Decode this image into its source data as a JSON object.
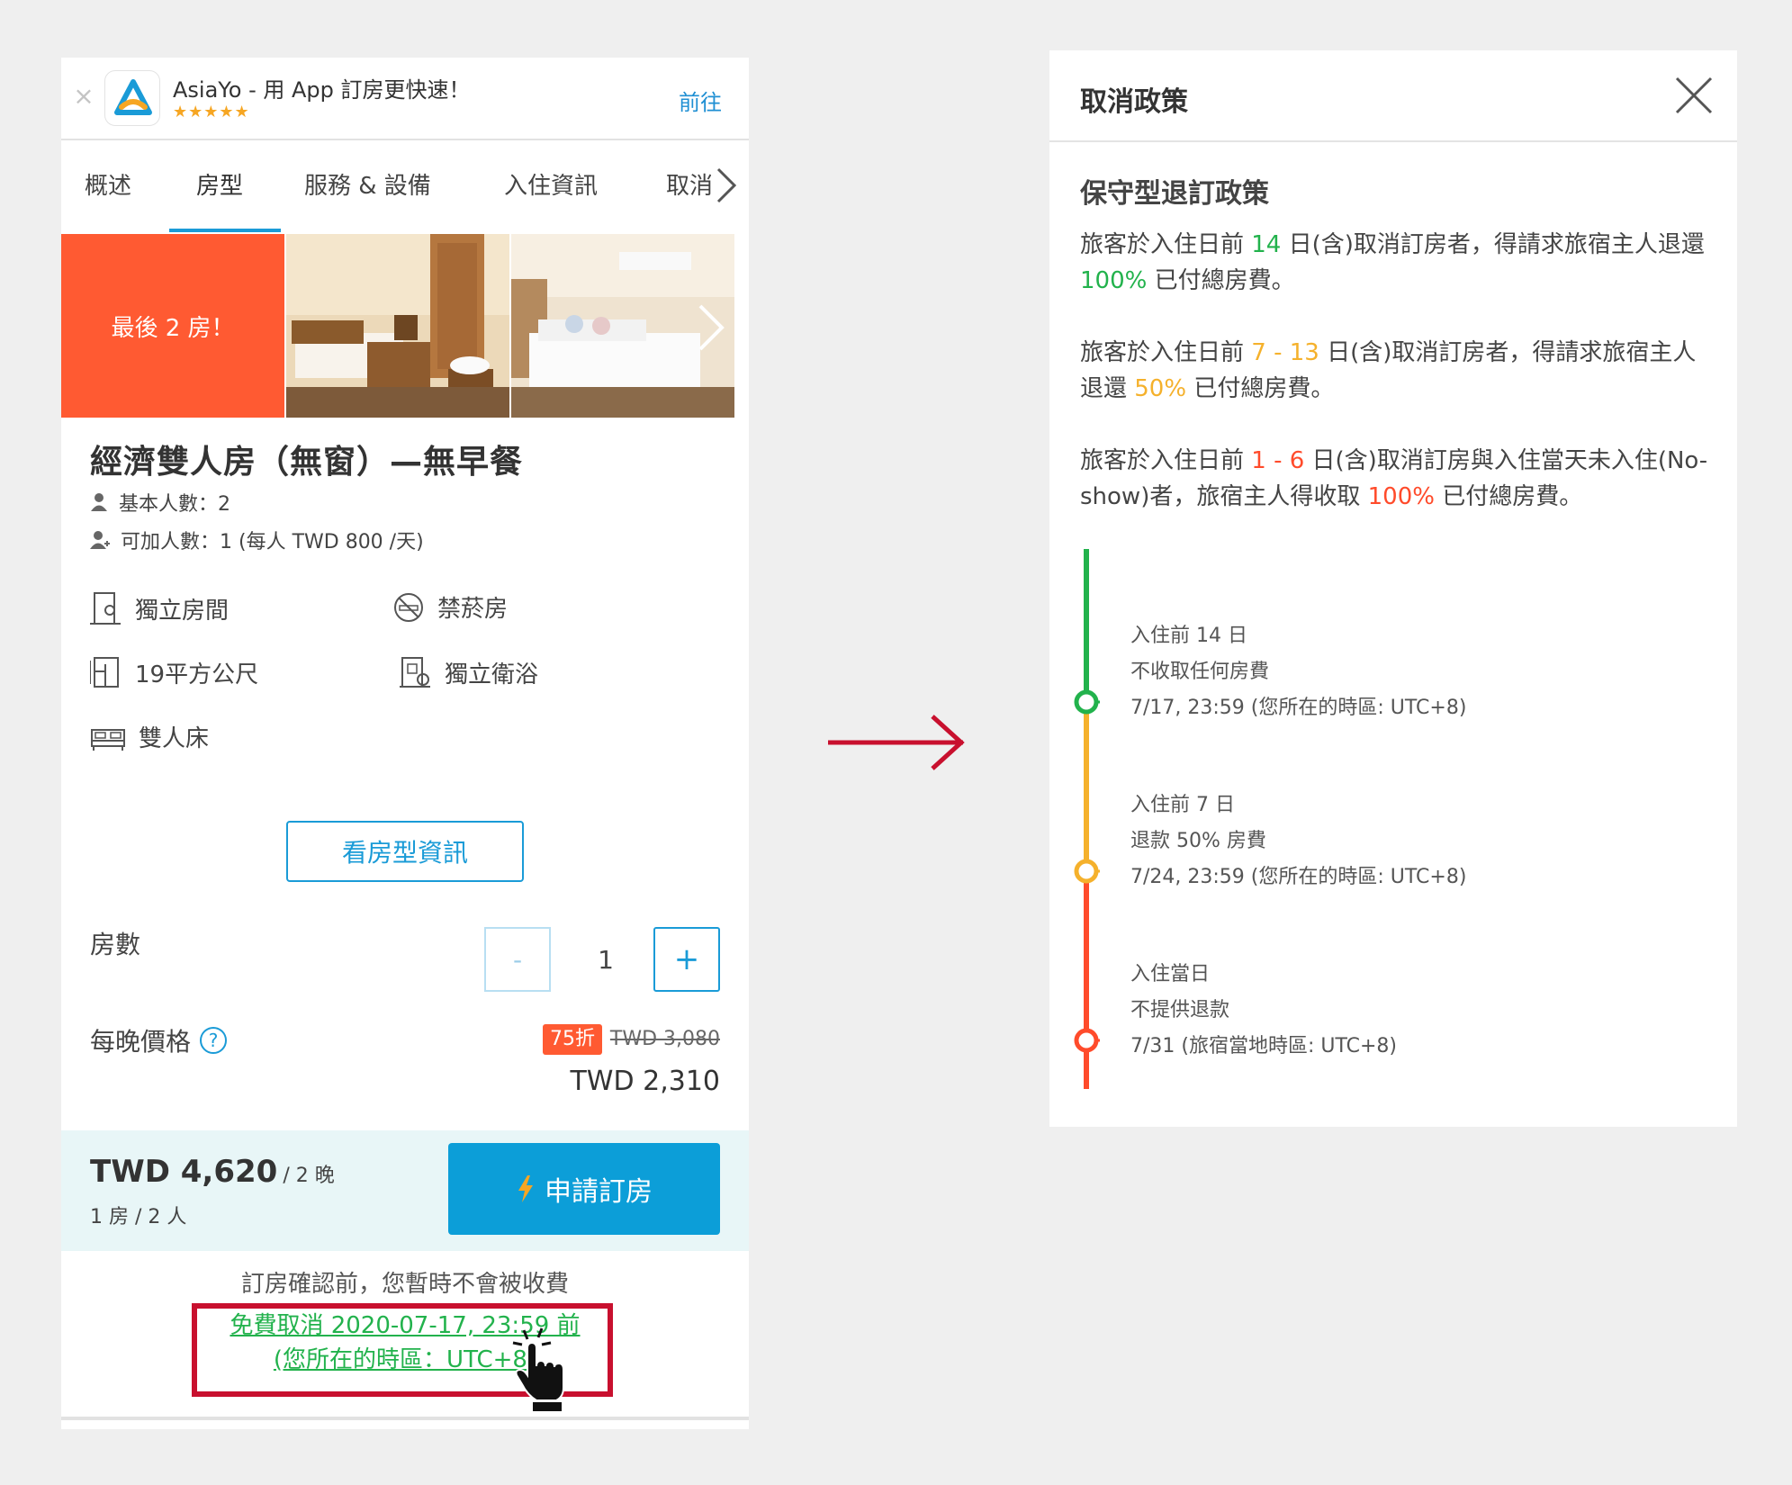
{
  "left": {
    "app_banner": {
      "close_glyph": "×",
      "title": "AsiaYo - 用 App 訂房更快速！",
      "stars": "★★★★★",
      "go": "前往"
    },
    "tabs": [
      "概述",
      "房型",
      "服務 & 設備",
      "入住資訊",
      "取消"
    ],
    "gallery": {
      "badge": "最後 2 房！"
    },
    "room": {
      "title": "經濟雙人房（無窗）—無早餐",
      "base_guests": "基本人數：2",
      "extra_guests": "可加人數：1 (每人 TWD 800 /天)",
      "features": [
        "獨立房間",
        "禁菸房",
        "19平方公尺",
        "獨立衛浴",
        "雙人床"
      ],
      "view_button": "看房型資訊"
    },
    "rooms_count": {
      "label": "房數",
      "minus": "-",
      "value": "1",
      "plus": "+"
    },
    "price": {
      "label": "每晚價格",
      "help": "?",
      "discount": "75折",
      "original": "TWD 3,080",
      "current": "TWD 2,310"
    },
    "summary": {
      "total": "TWD 4,620",
      "total_unit": "/ 2 晚",
      "sub": "1 房 / 2 人",
      "book_button": "申請訂房"
    },
    "no_charge": "訂房確認前，您暫時不會被收費",
    "free_cancel_line1": "免費取消 2020-07-17, 23:59 前",
    "free_cancel_line2": "(您所在的時區：UTC+8)"
  },
  "right": {
    "title": "取消政策",
    "subtitle": "保守型退訂政策",
    "p1": {
      "a": "旅客於入住日前 ",
      "n": "14",
      "b": " 日(含)取消訂房者，得請求旅宿主人退還 ",
      "pct": "100%",
      "c": " 已付總房費。"
    },
    "p2": {
      "a": "旅客於入住日前 ",
      "n": "7 - 13",
      "b": " 日(含)取消訂房者，得請求旅宿主人退還 ",
      "pct": "50%",
      "c": " 已付總房費。"
    },
    "p3": {
      "a": "旅客於入住日前 ",
      "n": "1 - 6",
      "b": " 日(含)取消訂房與入住當天未入住(No-show)者，旅宿主人得收取 ",
      "pct": "100%",
      "c": " 已付總房費。"
    },
    "timeline": [
      {
        "label": "入住前 14 日",
        "status": "不收取任何房費",
        "date": "7/17, 23:59 (您所在的時區: UTC+8)",
        "color": "#22b24c"
      },
      {
        "label": "入住前 7 日",
        "status": "退款 50% 房費",
        "date": "7/24, 23:59 (您所在的時區: UTC+8)",
        "color": "#f5b12c"
      },
      {
        "label": "入住當日",
        "status": "不提供退款",
        "date": "7/31 (旅宿當地時區: UTC+8)",
        "color": "#ff4b2b"
      }
    ]
  },
  "colors": {
    "accent": "#1a9bd7",
    "green": "#22b24c",
    "orange": "#f5b12c",
    "red": "#ff4b2b",
    "badge": "#ff5a32",
    "highlight": "#c8102e"
  }
}
